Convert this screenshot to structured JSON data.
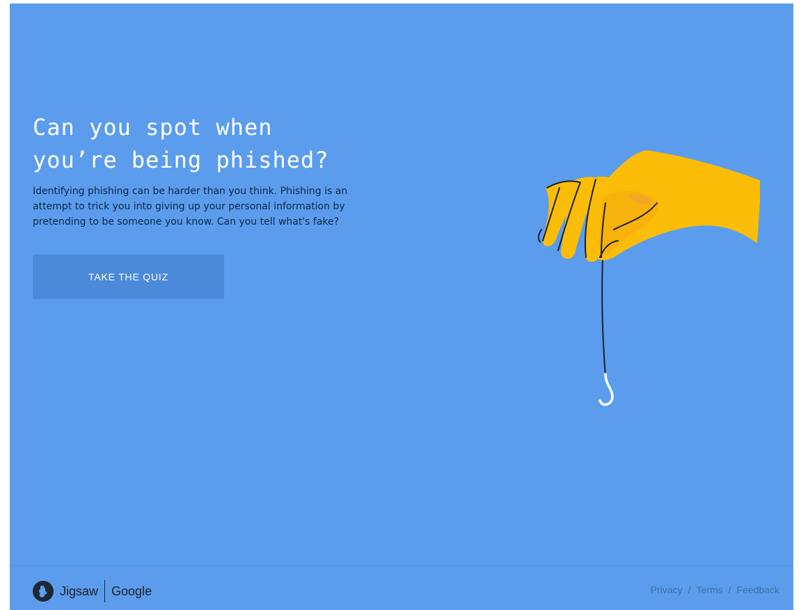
{
  "hero": {
    "title_line1": "Can you spot when",
    "title_line2": "you’re being phished?",
    "desc_line1": "Identifying phishing can be harder than you think. Phishing is an",
    "desc_line2": "attempt to trick you into giving up your personal information by",
    "desc_line3": "pretending to be someone you know. Can you tell what's fake?",
    "button_label": "TAKE THE QUIZ"
  },
  "footer": {
    "brand_jigsaw": "Jigsaw",
    "brand_google": "Google",
    "links": {
      "privacy": "Privacy",
      "terms": "Terms",
      "feedback": "Feedback",
      "separator": "/"
    }
  },
  "colors": {
    "background": "#5b9dec",
    "button": "#4a8ad8",
    "hand": "#fbbd08",
    "text_dark": "#0c2748"
  },
  "icons": {
    "logo": "jigsaw-logo-icon",
    "illustration": "hand-holding-hook-icon"
  }
}
